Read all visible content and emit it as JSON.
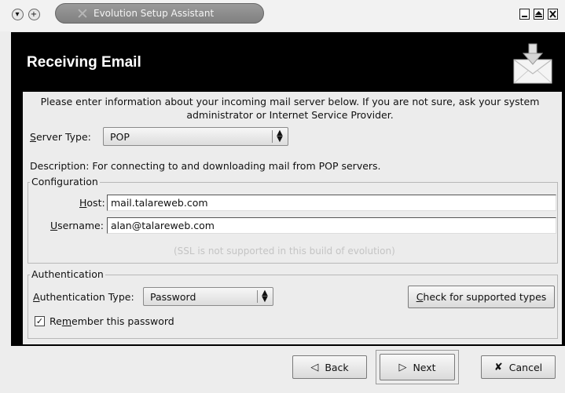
{
  "window": {
    "title": "Evolution Setup Assistant",
    "menu_icon": "chevron-down-icon",
    "shade_icon": "plus-icon",
    "minimize_icon": "minimize-icon",
    "maximize_icon": "maximize-icon",
    "close_icon": "close-icon"
  },
  "header": {
    "title": "Receiving Email",
    "icon": "mail-receive-icon"
  },
  "intro_text": "Please enter information about your incoming mail server below. If you are not sure, ask your system administrator or Internet Service Provider.",
  "server_type": {
    "label_mnemonic": "S",
    "label_rest": "erver Type:",
    "value": "POP",
    "description": "Description: For connecting to and downloading mail from POP servers."
  },
  "configuration": {
    "title": "Configuration",
    "host_label_mnemonic": "H",
    "host_label_rest": "ost:",
    "host_value": "mail.talareweb.com",
    "username_label_mnemonic": "U",
    "username_label_rest": "sername:",
    "username_value": "alan@talareweb.com",
    "ssl_note": "(SSL is not supported in this build of evolution)"
  },
  "authentication": {
    "title": "Authentication",
    "type_label_mnemonic": "A",
    "type_label_rest": "uthentication Type:",
    "type_value": "Password",
    "check_button_mnemonic": "C",
    "check_button_rest": "heck for supported types",
    "remember_prefix": "Re",
    "remember_mnemonic": "m",
    "remember_rest": "ember this password",
    "remember_checked": true
  },
  "buttons": {
    "back": "Back",
    "next": "Next",
    "cancel": "Cancel"
  },
  "colors": {
    "frame": "#000000",
    "background": "#ececec",
    "title_pill": "#8c8c8c"
  }
}
